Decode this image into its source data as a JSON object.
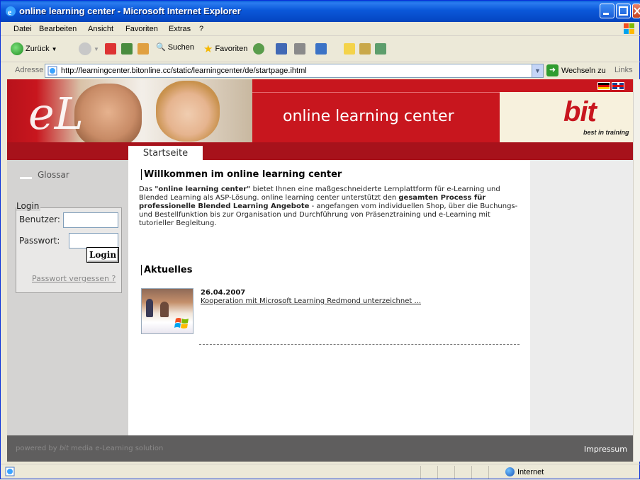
{
  "window": {
    "title": "online learning center - Microsoft Internet Explorer"
  },
  "menu": [
    "Datei",
    "Bearbeiten",
    "Ansicht",
    "Favoriten",
    "Extras",
    "?"
  ],
  "toolbar": {
    "back_label": "Zurück",
    "search_label": "Suchen",
    "favorites_label": "Favoriten"
  },
  "address": {
    "label": "Adresse",
    "url": "http://learningcenter.bitonline.cc/static/learningcenter/de/startpage.ihtml",
    "go_label": "Wechseln zu",
    "links_label": "Links"
  },
  "header": {
    "logo_text": "eL",
    "slogan": "online learning center",
    "brand": "bit",
    "brand_tagline": "best in training"
  },
  "nav": {
    "active_tab": "Startseite"
  },
  "sidebar": {
    "glossar_label": "Glossar",
    "login": {
      "title": "Login",
      "username_label": "Benutzer:",
      "username_value": "",
      "password_label": "Passwort:",
      "password_value": "",
      "button_label": "Login",
      "forgot_label": "Passwort vergessen ?"
    }
  },
  "main": {
    "welcome_title": "Willkommen im online learning center",
    "intro": {
      "p1": "Das ",
      "b1": "\"online learning center\"",
      "p2": " bietet Ihnen eine maßgeschneiderte Lernplattform für e-Learning und Blended Learning als ASP-Lösung. online learning center unterstützt den ",
      "b2": "gesamten Process für professionelle Blended Learning Angebote",
      "p3": " - angefangen vom individuellen Shop, über die Buchungs- und Bestellfunktion bis zur Organisation und Durchführung von Präsenztraining und e-Learning mit tutorieller Begleitung."
    },
    "news_title": "Aktuelles",
    "news": [
      {
        "date": "26.04.2007",
        "link": "Kooperation mit Microsoft Learning Redmond unterzeichnet ..."
      }
    ]
  },
  "footer": {
    "powered_prefix": "powered by ",
    "powered_brand": "bit",
    "powered_suffix": " media e-Learning solution",
    "impressum": "Impressum"
  },
  "status": {
    "zone": "Internet"
  },
  "colors": {
    "brand_red": "#c8161e",
    "nav_red": "#a7121b",
    "footer_gray": "#5f5e5e",
    "sidebar_gray": "#d4d3d2"
  }
}
